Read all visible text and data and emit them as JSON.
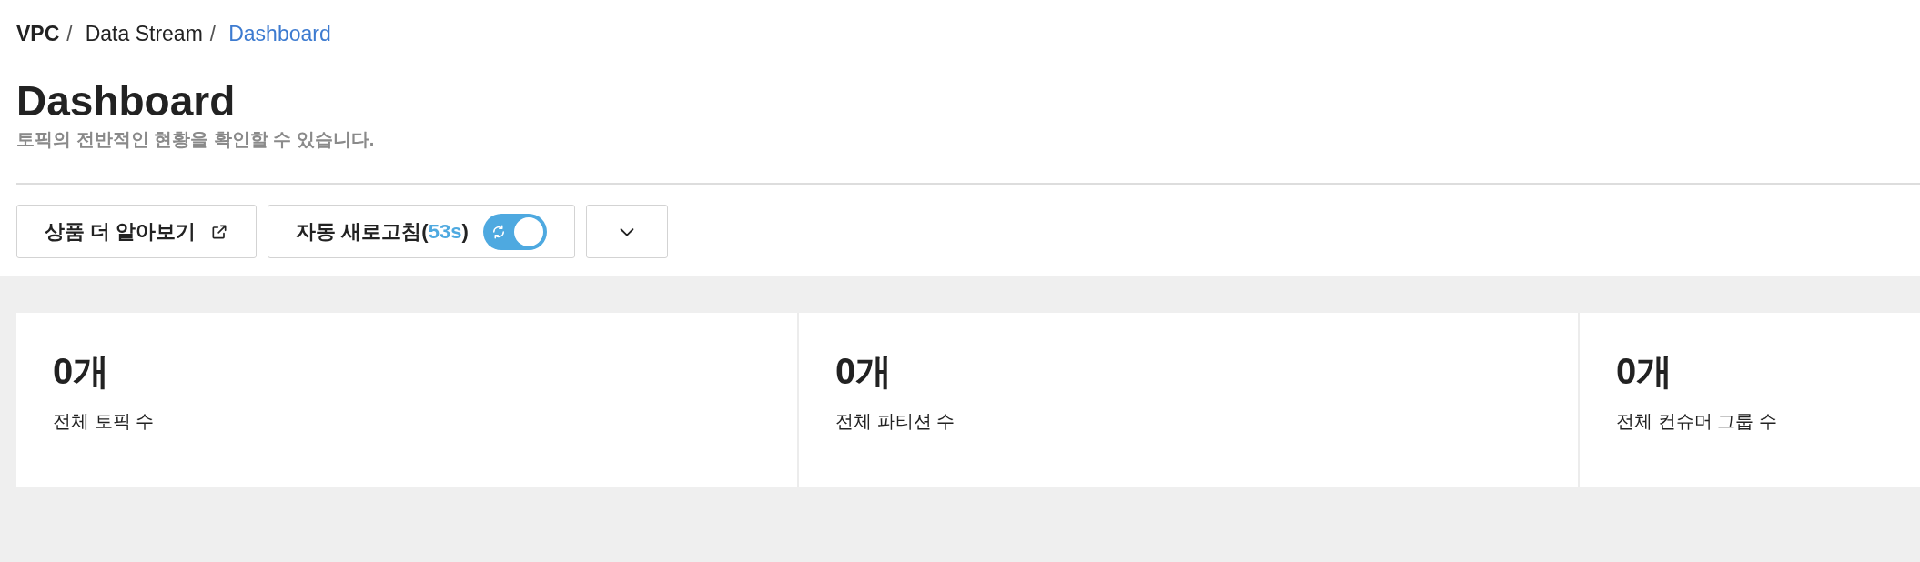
{
  "breadcrumb": {
    "separator": "/",
    "items": [
      {
        "label": "VPC",
        "kind": "root",
        "selected": false
      },
      {
        "label": "Data Stream",
        "kind": "link",
        "selected": false
      },
      {
        "label": "Dashboard",
        "kind": "link",
        "selected": true
      }
    ]
  },
  "page": {
    "title": "Dashboard",
    "subtitle": "토픽의 전반적인 현황을 확인할 수 있습니다."
  },
  "toolbar": {
    "learn_more": {
      "label": "상품 더 알아보기"
    },
    "auto_refresh": {
      "label_prefix": "자동 새로고침(",
      "countdown": "53s",
      "label_suffix": ")",
      "on": true
    }
  },
  "stats": [
    {
      "value": "0개",
      "label": "전체 토픽 수"
    },
    {
      "value": "0개",
      "label": "전체 파티션 수"
    },
    {
      "value": "0개",
      "label": "전체 컨슈머 그룹 수"
    }
  ]
}
